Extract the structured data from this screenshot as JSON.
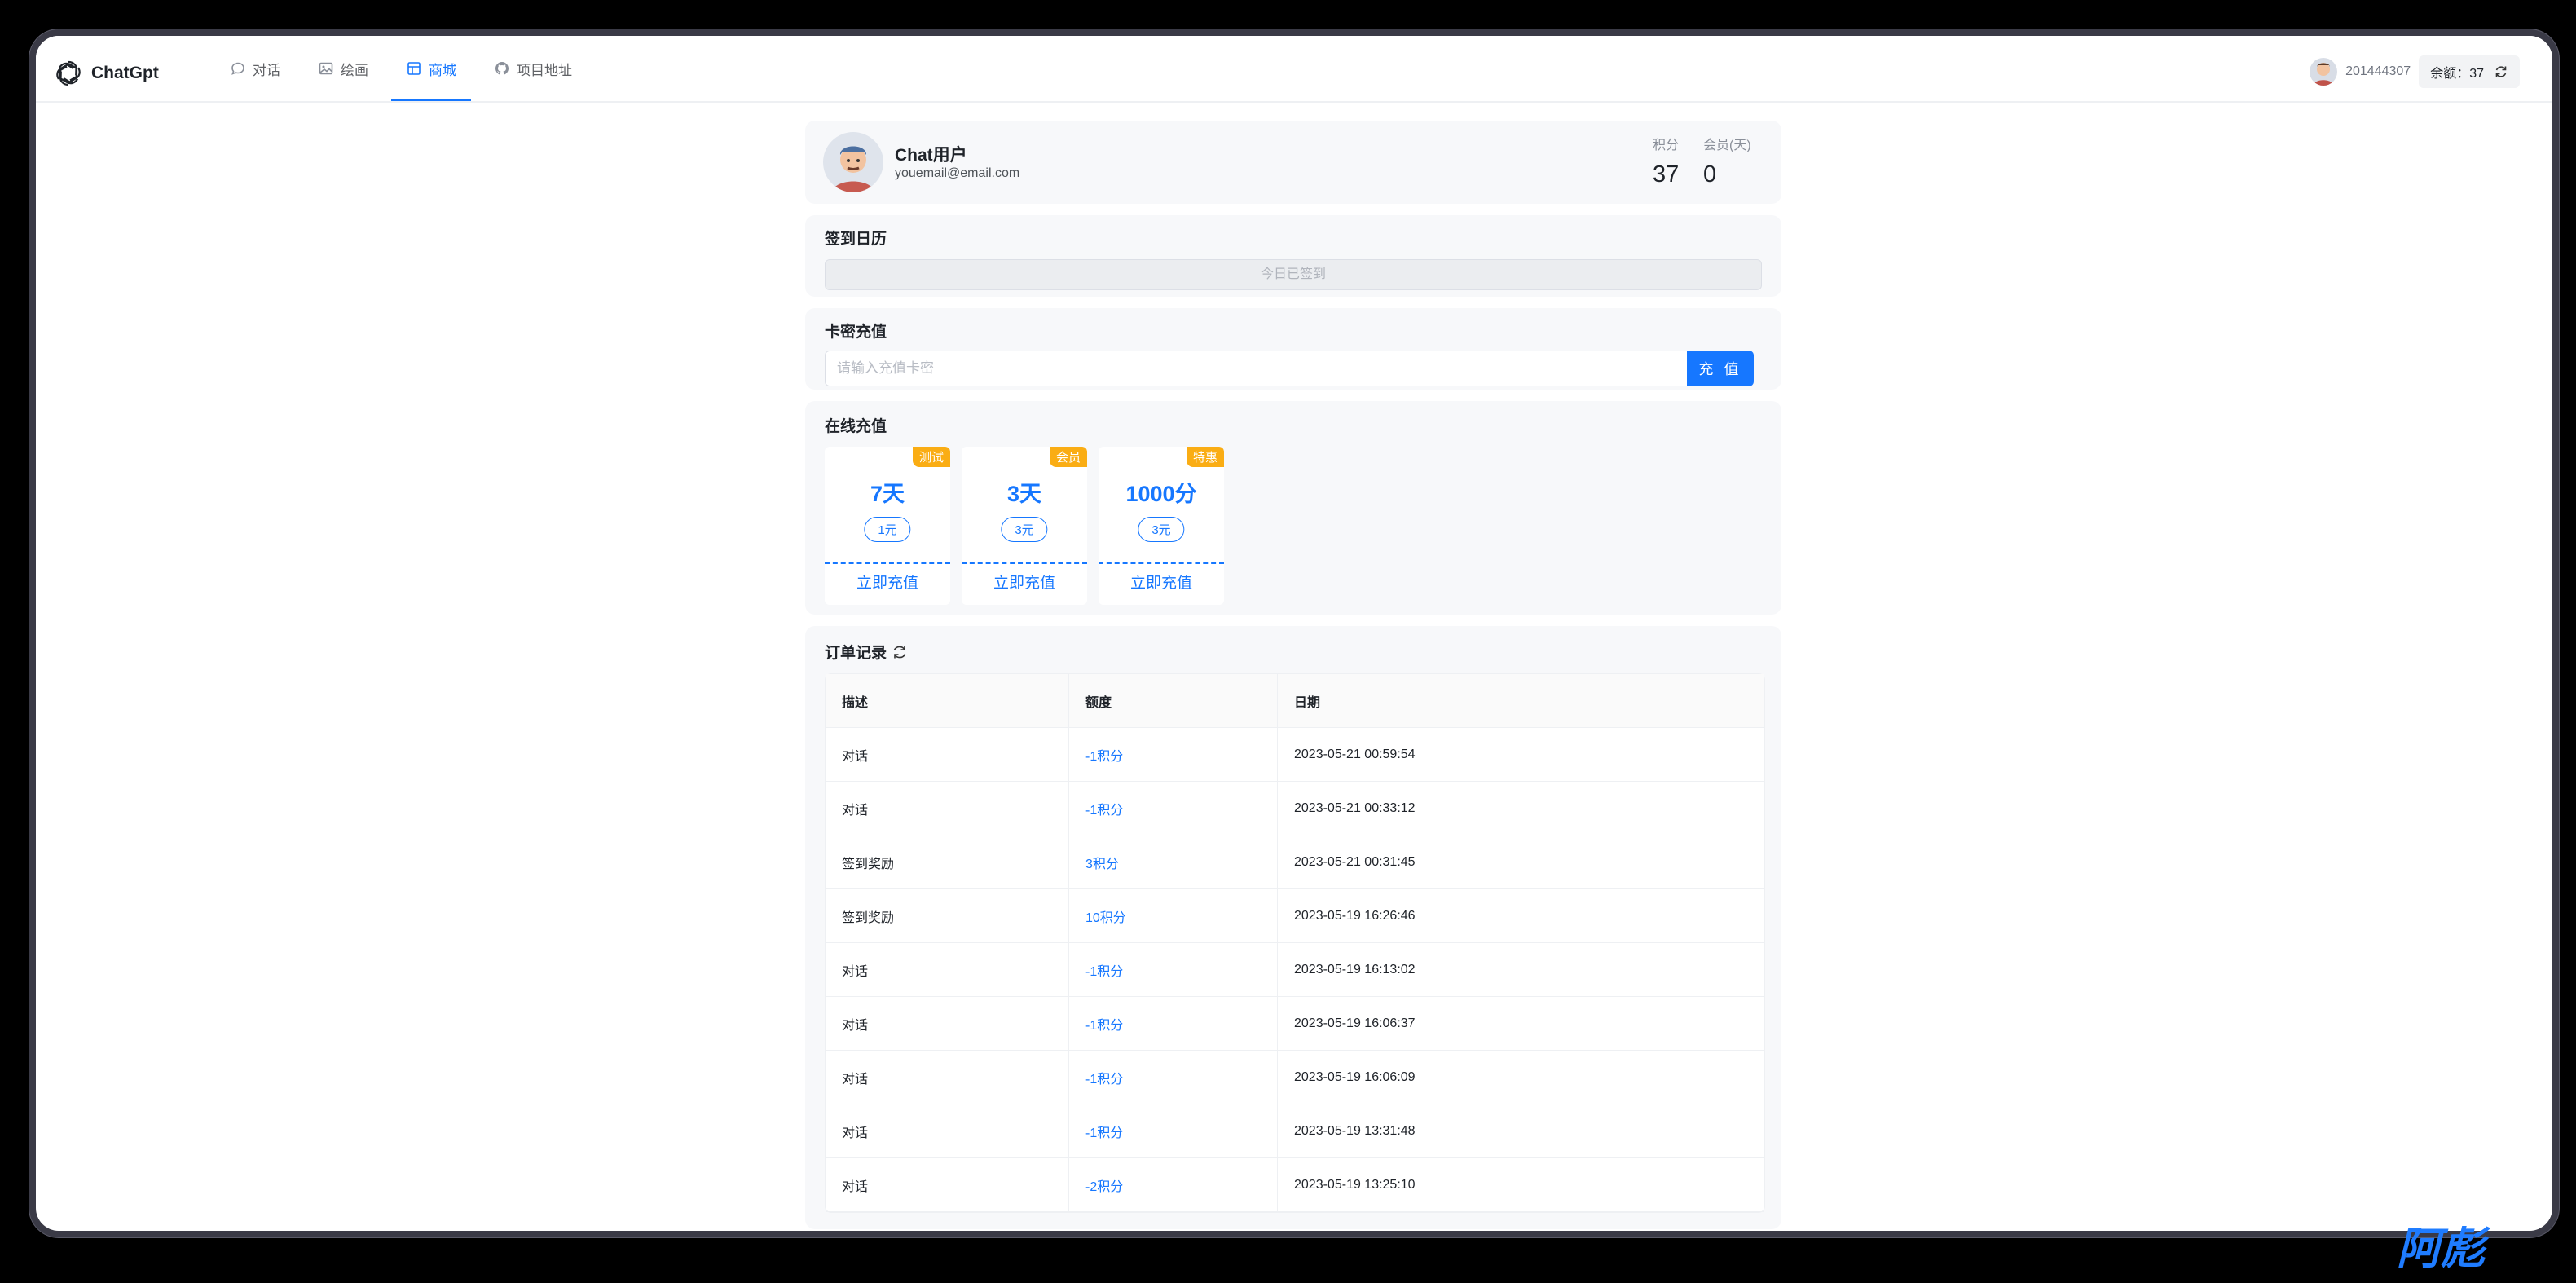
{
  "app": {
    "name": "ChatGpt"
  },
  "nav": [
    {
      "label": "对话",
      "icon": "chat-bubble-icon",
      "active": false
    },
    {
      "label": "绘画",
      "icon": "image-icon",
      "active": false
    },
    {
      "label": "商城",
      "icon": "shop-icon",
      "active": true
    },
    {
      "label": "项目地址",
      "icon": "github-icon",
      "active": false
    }
  ],
  "user": {
    "id": "201444307",
    "balance_label": "余额：37",
    "name": "Chat用户",
    "email": "youemail@email.com"
  },
  "stats": {
    "points_label": "积分",
    "points": "37",
    "vip_label": "会员(天)",
    "vip_days": "0"
  },
  "signin": {
    "title": "签到日历",
    "status": "今日已签到"
  },
  "card_recharge": {
    "title": "卡密充值",
    "placeholder": "请输入充值卡密",
    "button": "充 值"
  },
  "online": {
    "title": "在线充值",
    "plans": [
      {
        "tag": "测试",
        "name": "7天",
        "price": "1元",
        "action": "立即充值"
      },
      {
        "tag": "会员",
        "name": "3天",
        "price": "3元",
        "action": "立即充值"
      },
      {
        "tag": "特惠",
        "name": "1000分",
        "price": "3元",
        "action": "立即充值"
      }
    ]
  },
  "orders": {
    "title": "订单记录",
    "columns": [
      "描述",
      "额度",
      "日期"
    ],
    "rows": [
      [
        "对话",
        "-1积分",
        "2023-05-21 00:59:54"
      ],
      [
        "对话",
        "-1积分",
        "2023-05-21 00:33:12"
      ],
      [
        "签到奖励",
        "3积分",
        "2023-05-21 00:31:45"
      ],
      [
        "签到奖励",
        "10积分",
        "2023-05-19 16:26:46"
      ],
      [
        "对话",
        "-1积分",
        "2023-05-19 16:13:02"
      ],
      [
        "对话",
        "-1积分",
        "2023-05-19 16:06:37"
      ],
      [
        "对话",
        "-1积分",
        "2023-05-19 16:06:09"
      ],
      [
        "对话",
        "-1积分",
        "2023-05-19 13:31:48"
      ],
      [
        "对话",
        "-2积分",
        "2023-05-19 13:25:10"
      ]
    ]
  },
  "watermark": "阿彪",
  "colors": {
    "accent": "#1677ff",
    "tag": "#faad14"
  }
}
